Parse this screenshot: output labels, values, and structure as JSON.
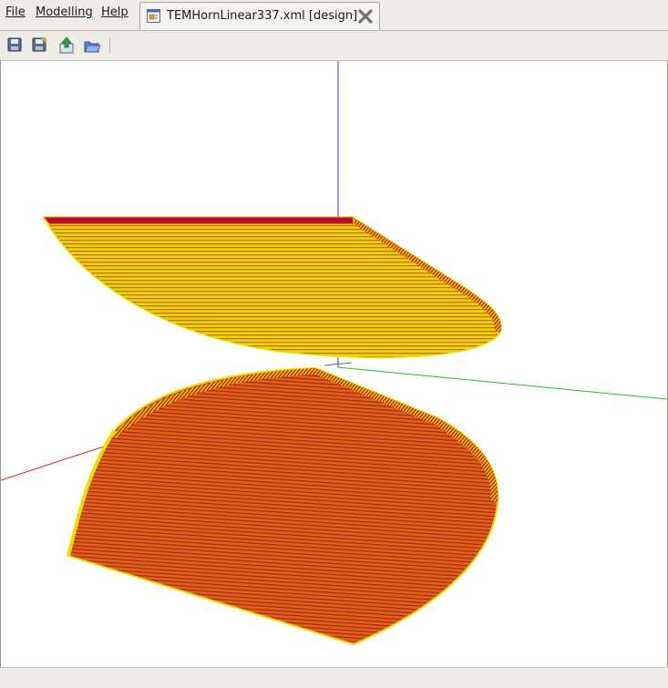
{
  "menubar": {
    "items": [
      {
        "label": "File"
      },
      {
        "label": "Modelling"
      },
      {
        "label": "Help"
      }
    ]
  },
  "tab": {
    "label": "TEMHornLinear337.xml [design]",
    "icon": "document-design-icon",
    "close_icon": "close-icon"
  },
  "toolbar": {
    "buttons": [
      {
        "icon": "save-icon"
      },
      {
        "icon": "save-as-icon"
      },
      {
        "icon": "export-icon"
      },
      {
        "icon": "open-icon"
      }
    ]
  },
  "viewport": {
    "background": "#ffffff",
    "axis_colors": {
      "x": "#e02020",
      "y": "#20c020",
      "z": "#3030e0"
    },
    "shape_colors": {
      "fill_yellow": "#e8e000",
      "fill_orange": "#d86a10",
      "edge_red": "#b8102a"
    }
  }
}
